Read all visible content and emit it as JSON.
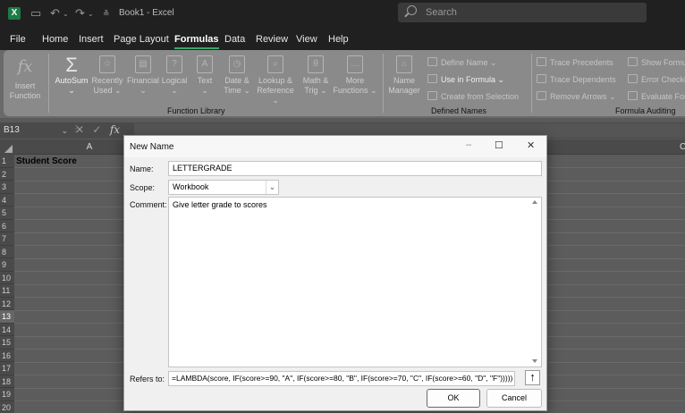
{
  "app": {
    "title": "Book1 - Excel",
    "logo_letter": "X"
  },
  "search": {
    "placeholder": "Search"
  },
  "menu": {
    "tabs": [
      "File",
      "Home",
      "Insert",
      "Page Layout",
      "Formulas",
      "Data",
      "Review",
      "View",
      "Help"
    ],
    "active": "Formulas"
  },
  "ribbon": {
    "insert_function": [
      "Insert",
      "Function"
    ],
    "autosum": "AutoSum",
    "function_library": [
      [
        "Recently",
        "Used"
      ],
      [
        "Financial",
        ""
      ],
      [
        "Logical",
        ""
      ],
      [
        "Text",
        ""
      ],
      [
        "Date &",
        "Time"
      ],
      [
        "Lookup &",
        "Reference"
      ],
      [
        "Math &",
        "Trig"
      ],
      [
        "More",
        "Functions"
      ]
    ],
    "group_function_library": "Function Library",
    "name_manager": [
      "Name",
      "Manager"
    ],
    "define_name": "Define Name",
    "use_in_formula": "Use in Formula",
    "create_from_selection": "Create from Selection",
    "group_defined_names": "Defined Names",
    "trace_precedents": "Trace Precedents",
    "trace_dependents": "Trace Dependents",
    "remove_arrows": "Remove Arrows",
    "show_formulas": "Show Formu",
    "error_checking": "Error Checki",
    "evaluate_formula": "Evaluate For",
    "group_formula_auditing": "Formula Auditing"
  },
  "formula_bar": {
    "name_box": "B13",
    "fx": "fx"
  },
  "grid": {
    "col_a": "A",
    "col_c": "C",
    "rows": [
      "1",
      "2",
      "3",
      "4",
      "5",
      "6",
      "7",
      "8",
      "9",
      "10",
      "11",
      "12",
      "13",
      "14",
      "15",
      "16",
      "17",
      "18",
      "19",
      "20"
    ],
    "selected_row": "13",
    "a1": "Student Score"
  },
  "dialog": {
    "title": "New Name",
    "name_label": "Name:",
    "name_value": "LETTERGRADE",
    "scope_label": "Scope:",
    "scope_value": "Workbook",
    "comment_label": "Comment:",
    "comment_value": "Give letter grade to scores",
    "refers_label": "Refers to:",
    "refers_value": "=LAMBDA(score, IF(score>=90, \"A\", IF(score>=80, \"B\", IF(score>=70, \"C\", IF(score>=60, \"D\", \"F\")))))",
    "ok": "OK",
    "cancel": "Cancel"
  }
}
